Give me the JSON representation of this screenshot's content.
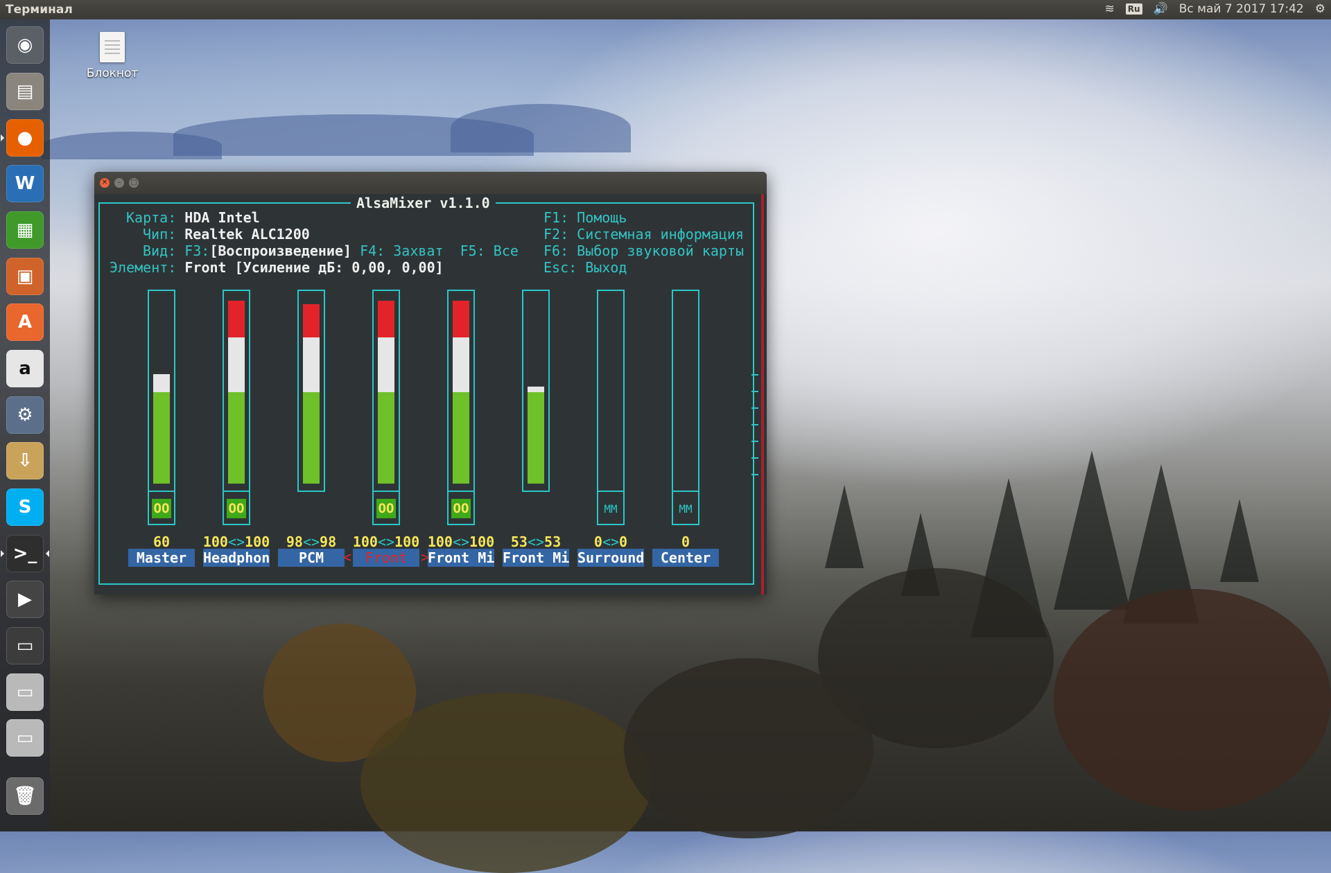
{
  "top_panel": {
    "title": "Терминал",
    "keyboard_layout": "Ru",
    "datetime": "Вс май  7 2017 17:42"
  },
  "desktop": {
    "icons": [
      {
        "label": "Блокнот",
        "icon": "text-document-icon"
      }
    ]
  },
  "launcher": {
    "items": [
      {
        "name": "ubuntu-dash-icon",
        "glyph": "◉",
        "color": "#5b5f66"
      },
      {
        "name": "file-manager-icon",
        "glyph": "▤",
        "color": "#8a857d"
      },
      {
        "name": "firefox-icon",
        "glyph": "●",
        "color": "#e66000"
      },
      {
        "name": "libreoffice-writer-icon",
        "glyph": "W",
        "color": "#2a6fb5"
      },
      {
        "name": "libreoffice-calc-icon",
        "glyph": "▦",
        "color": "#3f9a2a"
      },
      {
        "name": "libreoffice-impress-icon",
        "glyph": "▣",
        "color": "#d0632a"
      },
      {
        "name": "software-center-icon",
        "glyph": "A",
        "color": "#e9662c"
      },
      {
        "name": "amazon-icon",
        "glyph": "a",
        "color": "#e6e6e6"
      },
      {
        "name": "system-settings-icon",
        "glyph": "⚙",
        "color": "#5b6f8a"
      },
      {
        "name": "archive-manager-icon",
        "glyph": "⇩",
        "color": "#c9a35a"
      },
      {
        "name": "skype-icon",
        "glyph": "S",
        "color": "#00aff0"
      },
      {
        "name": "terminal-icon",
        "glyph": ">_",
        "color": "#2e2e2e"
      },
      {
        "name": "video-editor-icon",
        "glyph": "▶",
        "color": "#444"
      },
      {
        "name": "floppy-save-icon",
        "glyph": "▭",
        "color": "#3c3c3c"
      },
      {
        "name": "drive-icon",
        "glyph": "▭",
        "color": "#b9b9b9"
      },
      {
        "name": "drive-2-icon",
        "glyph": "▭",
        "color": "#b9b9b9"
      },
      {
        "name": "trash-icon",
        "glyph": "🗑",
        "color": "#6b6b6b"
      }
    ]
  },
  "mixer": {
    "title": "AlsaMixer v1.1.0",
    "card_label": "Карта:",
    "card_value": "HDA Intel",
    "chip_label": "Чип:",
    "chip_value": "Realtek ALC1200",
    "view_label": "Вид:",
    "view_f3": "F3:",
    "view_playback": "[Воспроизведение]",
    "view_f4": "F4: Захват",
    "view_f5": "F5: Все",
    "element_label": "Элемент:",
    "element_value": "Front [Усиление дБ: 0,00, 0,00]",
    "keys": {
      "f1": "F1: Помощь",
      "f2": "F2: Системная информация",
      "f6": "F6: Выбор звуковой карты",
      "esc": "Esc: Выход"
    },
    "channels": [
      {
        "name": "Master",
        "value_left": "60",
        "value_sep": "",
        "value_right": "",
        "level": 0.6,
        "mute": "OO",
        "muted": false,
        "has_switch": true,
        "selected": false
      },
      {
        "name": "Headphon",
        "value_left": "100",
        "value_sep": "<>",
        "value_right": "100",
        "level": 1.0,
        "mute": "OO",
        "muted": false,
        "has_switch": true,
        "selected": false
      },
      {
        "name": "PCM",
        "value_left": "98",
        "value_sep": "<>",
        "value_right": "98",
        "level": 0.98,
        "mute": "",
        "muted": false,
        "has_switch": false,
        "selected": false
      },
      {
        "name": "Front",
        "value_left": "100",
        "value_sep": "<>",
        "value_right": "100",
        "level": 1.0,
        "mute": "OO",
        "muted": false,
        "has_switch": true,
        "selected": true
      },
      {
        "name": "Front Mi",
        "value_left": "100",
        "value_sep": "<>",
        "value_right": "100",
        "level": 1.0,
        "mute": "OO",
        "muted": false,
        "has_switch": true,
        "selected": false
      },
      {
        "name": "Front Mi",
        "value_left": "53",
        "value_sep": "<>",
        "value_right": "53",
        "level": 0.53,
        "mute": "",
        "muted": false,
        "has_switch": false,
        "selected": false
      },
      {
        "name": "Surround",
        "value_left": "0",
        "value_sep": "<>",
        "value_right": "0",
        "level": 0.0,
        "mute": "MM",
        "muted": true,
        "has_switch": true,
        "selected": false
      },
      {
        "name": "Center",
        "value_left": "0",
        "value_sep": "",
        "value_right": "",
        "level": 0.0,
        "mute": "MM",
        "muted": true,
        "has_switch": true,
        "selected": false
      }
    ]
  }
}
